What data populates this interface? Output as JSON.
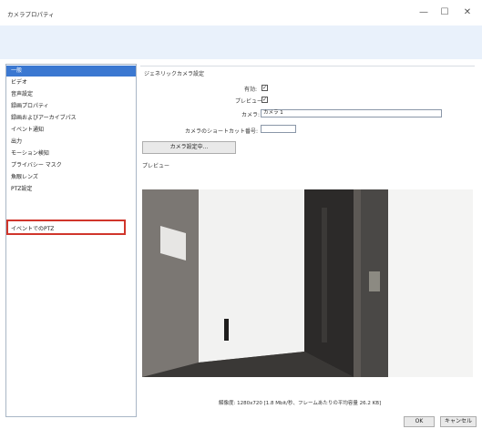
{
  "window": {
    "title": "カメラプロパティ",
    "minimize_glyph": "—",
    "maximize_glyph": "☐",
    "close_glyph": "✕"
  },
  "sidebar": {
    "items": [
      {
        "label": "一般"
      },
      {
        "label": "ビデオ"
      },
      {
        "label": "音声設定"
      },
      {
        "label": "録画プロパティ"
      },
      {
        "label": "録画およびアーカイブパス"
      },
      {
        "label": "イベント通知"
      },
      {
        "label": "出力"
      },
      {
        "label": "モーション検知"
      },
      {
        "label": "プライバシー マスク"
      },
      {
        "label": "魚眼レンズ"
      },
      {
        "label": "PTZ設定"
      },
      {
        "label": "イベントでのPTZ"
      }
    ]
  },
  "general": {
    "section_title": "ジェネリックカメラ設定",
    "enabled_label": "有効:",
    "preview_label": "プレビュー:",
    "camera_label": "カメラ:",
    "camera_value": "カメラ 1",
    "shortcut_label": "カメラのショートカット番号:",
    "shortcut_value": "",
    "camera_settings_button": "カメラ設定中..."
  },
  "preview": {
    "label": "プレビュー",
    "resolution_text": "解像度: 1280x720 [1.8 Mbit/秒、フレームあたりの平均容量 26.2 KB]"
  },
  "footer": {
    "ok_label": "OK",
    "cancel_label": "キャンセル"
  }
}
